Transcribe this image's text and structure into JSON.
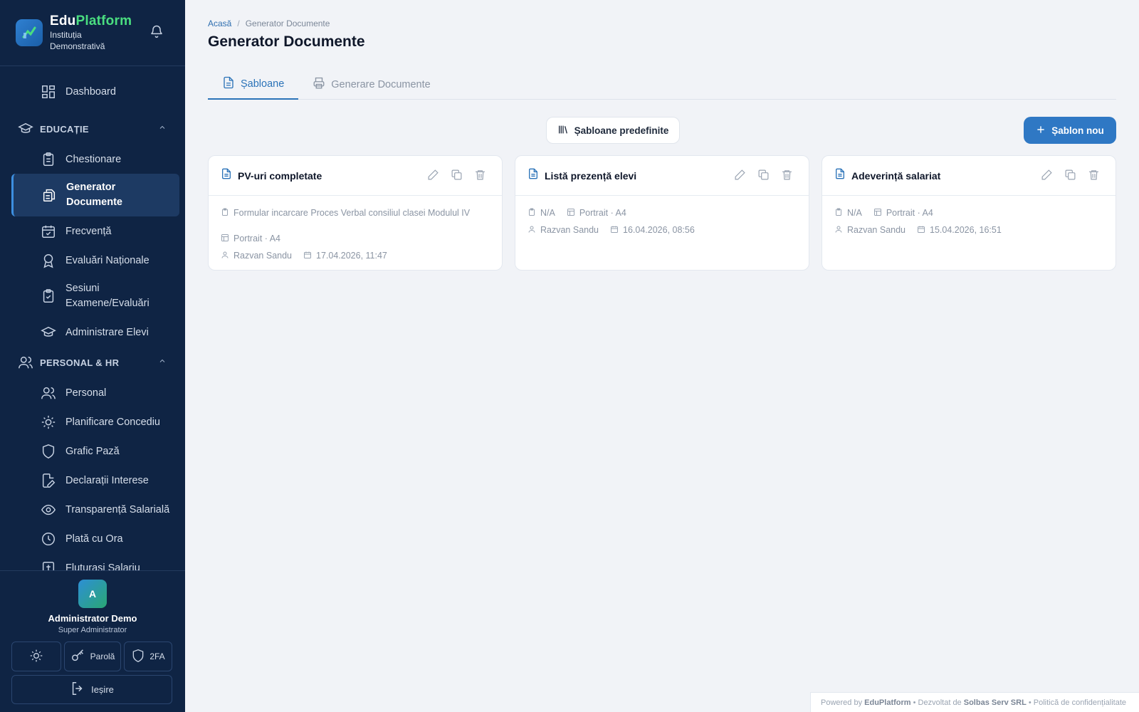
{
  "brand": {
    "name_part1": "Edu",
    "name_part2": "Platform",
    "institution": "Instituția Demonstrativă"
  },
  "sidebar": {
    "items_top": [
      {
        "label": "Dashboard",
        "icon": "dashboard-icon"
      }
    ],
    "sections": [
      {
        "label": "EDUCAȚIE",
        "icon": "graduation-cap-icon",
        "items": [
          {
            "label": "Chestionare",
            "icon": "clipboard-icon"
          },
          {
            "label": "Generator Documente",
            "icon": "documents-icon",
            "active": true
          },
          {
            "label": "Frecvență",
            "icon": "calendar-check-icon"
          },
          {
            "label": "Evaluări Naționale",
            "icon": "award-icon"
          },
          {
            "label": "Sesiuni Examene/Evaluări",
            "icon": "clipboard-check-icon"
          },
          {
            "label": "Administrare Elevi",
            "icon": "graduation-cap-icon"
          }
        ]
      },
      {
        "label": "PERSONAL & HR",
        "icon": "users-icon",
        "items": [
          {
            "label": "Personal",
            "icon": "users-icon"
          },
          {
            "label": "Planificare Concediu",
            "icon": "sun-icon"
          },
          {
            "label": "Grafic Pază",
            "icon": "shield-icon"
          },
          {
            "label": "Declarații Interese",
            "icon": "file-edit-icon"
          },
          {
            "label": "Transparență Salarială",
            "icon": "eye-icon"
          },
          {
            "label": "Plată cu Ora",
            "icon": "clock-icon"
          },
          {
            "label": "Fluturași Salariu",
            "icon": "receipt-icon"
          }
        ]
      }
    ]
  },
  "user": {
    "initial": "A",
    "name": "Administrator Demo",
    "role": "Super Administrator",
    "password_label": "Parolă",
    "twofa_label": "2FA",
    "logout_label": "Ieșire"
  },
  "breadcrumb": {
    "home": "Acasă",
    "separator": "/",
    "current": "Generator Documente"
  },
  "page": {
    "title": "Generator Documente"
  },
  "tabs": [
    {
      "label": "Șabloane",
      "icon": "file-text-icon",
      "active": true
    },
    {
      "label": "Generare Documente",
      "icon": "printer-icon",
      "active": false
    }
  ],
  "toolbar": {
    "predefined_label": "Șabloane predefinite",
    "new_label": "Șablon nou"
  },
  "templates": [
    {
      "title": "PV-uri completate",
      "description": "Formular incarcare Proces Verbal consiliul clasei Modulul IV",
      "format": "Portrait · A4",
      "author": "Razvan Sandu",
      "date": "17.04.2026, 11:47"
    },
    {
      "title": "Listă prezență elevi",
      "description": "N/A",
      "format": "Portrait · A4",
      "author": "Razvan Sandu",
      "date": "16.04.2026, 08:56"
    },
    {
      "title": "Adeverință salariat",
      "description": "N/A",
      "format": "Portrait · A4",
      "author": "Razvan Sandu",
      "date": "15.04.2026, 16:51"
    }
  ],
  "footer": {
    "powered": "Powered by",
    "brand": "EduPlatform",
    "dev": "• Dezvoltat de",
    "company": "Solbas Serv SRL",
    "privacy": "• Politică de confidențialitate"
  },
  "colors": {
    "sidebar_bg": "#0f2444",
    "accent": "#2f78c4",
    "brand_green": "#4ade80"
  }
}
